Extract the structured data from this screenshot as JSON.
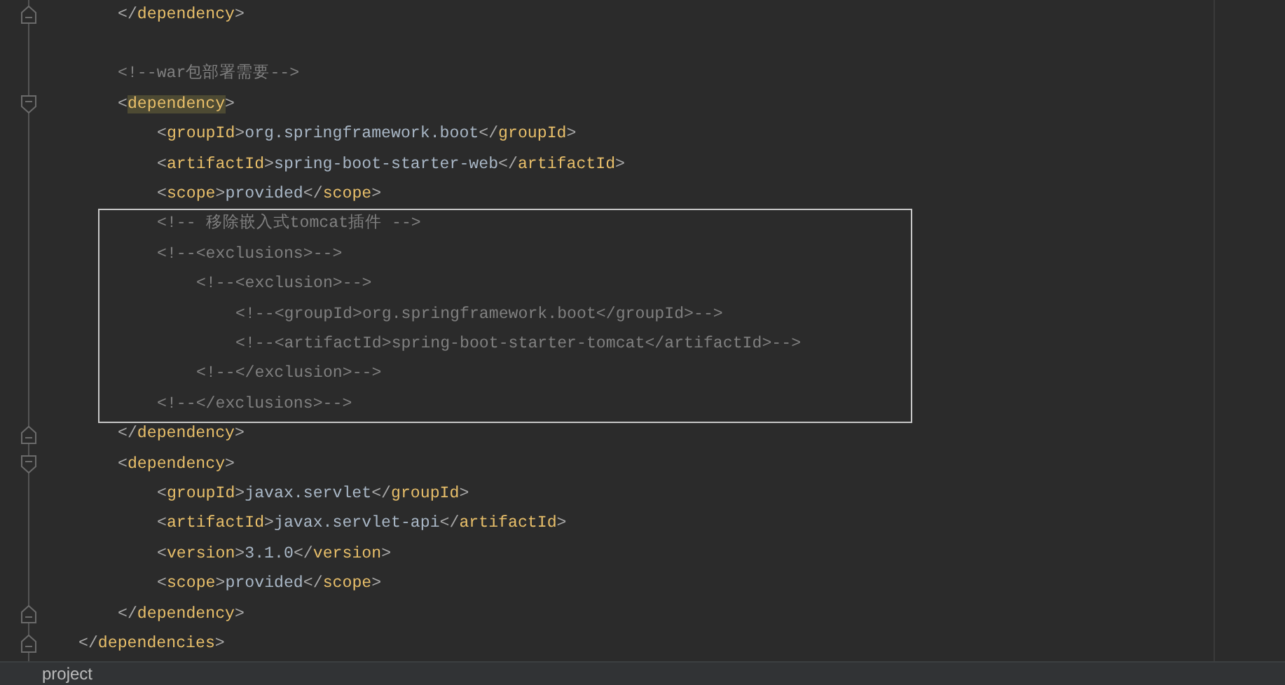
{
  "editor": {
    "lines": [
      {
        "children": [
          {
            "kind": "fold-end",
            "tokens": [
              {
                "kind": "p",
                "t": "</"
              },
              {
                "kind": "tag",
                "t": "dependency"
              },
              {
                "kind": "p",
                "t": ">"
              }
            ]
          },
          {
            "kind": "blank"
          },
          {
            "tokens": [
              {
                "kind": "comment",
                "t": "<!--war包部署需要-->"
              }
            ]
          },
          {
            "kind": "fold-start",
            "tokens": [
              {
                "kind": "p",
                "t": "<"
              },
              {
                "kind": "tag-match",
                "t": "dependency"
              },
              {
                "kind": "p",
                "t": ">"
              }
            ],
            "children": [
              {
                "tokens": [
                  {
                    "kind": "p",
                    "t": "<"
                  },
                  {
                    "kind": "tag",
                    "t": "groupId"
                  },
                  {
                    "kind": "p",
                    "t": ">"
                  },
                  {
                    "kind": "text",
                    "t": "org.springframework.boot"
                  },
                  {
                    "kind": "p",
                    "t": "</"
                  },
                  {
                    "kind": "tag",
                    "t": "groupId"
                  },
                  {
                    "kind": "p",
                    "t": ">"
                  }
                ]
              },
              {
                "tokens": [
                  {
                    "kind": "p",
                    "t": "<"
                  },
                  {
                    "kind": "tag",
                    "t": "artifactId"
                  },
                  {
                    "kind": "p",
                    "t": ">"
                  },
                  {
                    "kind": "text",
                    "t": "spring-boot-starter-web"
                  },
                  {
                    "kind": "p",
                    "t": "</"
                  },
                  {
                    "kind": "tag",
                    "t": "artifactId"
                  },
                  {
                    "kind": "p",
                    "t": ">"
                  }
                ]
              },
              {
                "tokens": [
                  {
                    "kind": "p",
                    "t": "<"
                  },
                  {
                    "kind": "tag",
                    "t": "scope"
                  },
                  {
                    "kind": "p",
                    "t": ">"
                  },
                  {
                    "kind": "text",
                    "t": "provided"
                  },
                  {
                    "kind": "p",
                    "t": "</"
                  },
                  {
                    "kind": "tag",
                    "t": "scope"
                  },
                  {
                    "kind": "p",
                    "t": ">"
                  }
                ]
              },
              {
                "tokens": [
                  {
                    "kind": "comment",
                    "t": "<!-- 移除嵌入式tomcat插件 -->"
                  }
                ]
              },
              {
                "tokens": [
                  {
                    "kind": "comment",
                    "t": "<!--<exclusions>-->"
                  }
                ],
                "children": [
                  {
                    "tokens": [
                      {
                        "kind": "comment",
                        "t": "<!--<exclusion>-->"
                      }
                    ],
                    "children": [
                      {
                        "tokens": [
                          {
                            "kind": "comment",
                            "t": "<!--<groupId>org.springframework.boot</groupId>-->"
                          }
                        ]
                      },
                      {
                        "tokens": [
                          {
                            "kind": "comment",
                            "t": "<!--<artifactId>spring-boot-starter-tomcat</artifactId>-->"
                          }
                        ]
                      }
                    ]
                  },
                  {
                    "tokens": [
                      {
                        "kind": "comment",
                        "t": "<!--</exclusion>-->"
                      }
                    ]
                  }
                ]
              },
              {
                "tokens": [
                  {
                    "kind": "comment",
                    "t": "<!--</exclusions>-->"
                  }
                ]
              }
            ]
          },
          {
            "kind": "fold-end",
            "tokens": [
              {
                "kind": "p",
                "t": "</"
              },
              {
                "kind": "tag",
                "t": "dependency"
              },
              {
                "kind": "p",
                "t": ">"
              }
            ]
          },
          {
            "kind": "fold-start",
            "tokens": [
              {
                "kind": "p",
                "t": "<"
              },
              {
                "kind": "tag",
                "t": "dependency"
              },
              {
                "kind": "p",
                "t": ">"
              }
            ],
            "children": [
              {
                "tokens": [
                  {
                    "kind": "p",
                    "t": "<"
                  },
                  {
                    "kind": "tag",
                    "t": "groupId"
                  },
                  {
                    "kind": "p",
                    "t": ">"
                  },
                  {
                    "kind": "text",
                    "t": "javax.servlet"
                  },
                  {
                    "kind": "p",
                    "t": "</"
                  },
                  {
                    "kind": "tag",
                    "t": "groupId"
                  },
                  {
                    "kind": "p",
                    "t": ">"
                  }
                ]
              },
              {
                "tokens": [
                  {
                    "kind": "p",
                    "t": "<"
                  },
                  {
                    "kind": "tag",
                    "t": "artifactId"
                  },
                  {
                    "kind": "p",
                    "t": ">"
                  },
                  {
                    "kind": "text",
                    "t": "javax.servlet-api"
                  },
                  {
                    "kind": "p",
                    "t": "</"
                  },
                  {
                    "kind": "tag",
                    "t": "artifactId"
                  },
                  {
                    "kind": "p",
                    "t": ">"
                  }
                ]
              },
              {
                "tokens": [
                  {
                    "kind": "p",
                    "t": "<"
                  },
                  {
                    "kind": "tag",
                    "t": "version"
                  },
                  {
                    "kind": "p",
                    "t": ">"
                  },
                  {
                    "kind": "text",
                    "t": "3.1.0"
                  },
                  {
                    "kind": "p",
                    "t": "</"
                  },
                  {
                    "kind": "tag",
                    "t": "version"
                  },
                  {
                    "kind": "p",
                    "t": ">"
                  }
                ]
              },
              {
                "tokens": [
                  {
                    "kind": "p",
                    "t": "<"
                  },
                  {
                    "kind": "tag",
                    "t": "scope"
                  },
                  {
                    "kind": "p",
                    "t": ">"
                  },
                  {
                    "kind": "text",
                    "t": "provided"
                  },
                  {
                    "kind": "p",
                    "t": "</"
                  },
                  {
                    "kind": "tag",
                    "t": "scope"
                  },
                  {
                    "kind": "p",
                    "t": ">"
                  }
                ]
              }
            ]
          },
          {
            "kind": "fold-end",
            "tokens": [
              {
                "kind": "p",
                "t": "</"
              },
              {
                "kind": "tag",
                "t": "dependency"
              },
              {
                "kind": "p",
                "t": ">"
              }
            ]
          }
        ]
      },
      {
        "kind": "fold-end",
        "tokens": [
          {
            "kind": "p",
            "t": "</"
          },
          {
            "kind": "tag",
            "t": "dependencies"
          },
          {
            "kind": "p",
            "t": ">"
          }
        ]
      }
    ]
  },
  "breadcrumb": {
    "items": [
      "project"
    ]
  }
}
